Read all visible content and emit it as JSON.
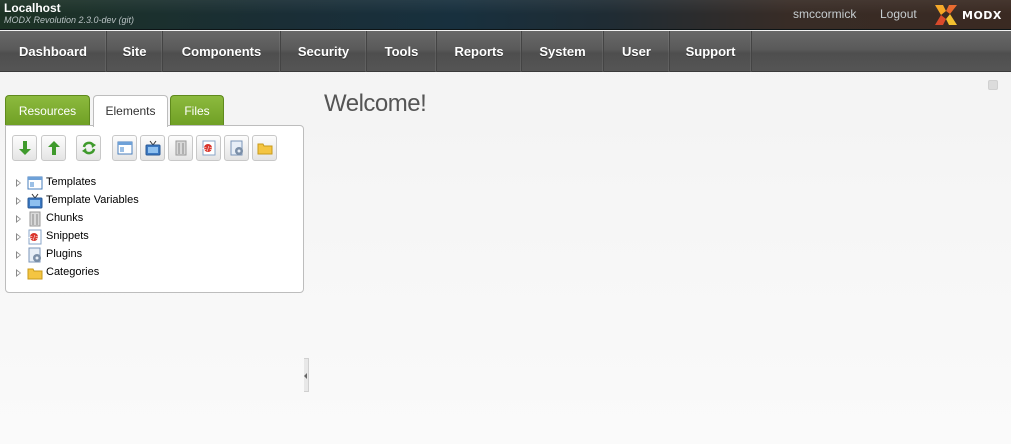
{
  "header": {
    "site_name": "Localhost",
    "version": "MODX Revolution 2.3.0-dev (git)",
    "username": "smccormick",
    "logout": "Logout",
    "logo_text": "MODX"
  },
  "nav": {
    "items": [
      "Dashboard",
      "Site",
      "Components",
      "Security",
      "Tools",
      "Reports",
      "System",
      "User",
      "Support"
    ]
  },
  "left_panel": {
    "tabs": [
      {
        "label": "Resources",
        "state": "inactive"
      },
      {
        "label": "Elements",
        "state": "active"
      },
      {
        "label": "Files",
        "state": "inactive"
      }
    ],
    "toolbar": [
      {
        "icon": "arrow-down-icon",
        "action": "expand"
      },
      {
        "icon": "arrow-up-icon",
        "action": "collapse"
      },
      {
        "icon": "refresh-icon",
        "action": "refresh"
      },
      {
        "icon": "template-icon",
        "action": "new template"
      },
      {
        "icon": "tv-icon",
        "action": "new tv"
      },
      {
        "icon": "chunk-icon",
        "action": "new chunk"
      },
      {
        "icon": "snippet-icon",
        "action": "new snippet"
      },
      {
        "icon": "plugin-icon",
        "action": "new plugin"
      },
      {
        "icon": "folder-icon",
        "action": "new category"
      }
    ],
    "tree": [
      {
        "label": "Templates",
        "icon": "template-icon"
      },
      {
        "label": "Template Variables",
        "icon": "tv-icon"
      },
      {
        "label": "Chunks",
        "icon": "chunk-icon"
      },
      {
        "label": "Snippets",
        "icon": "snippet-icon"
      },
      {
        "label": "Plugins",
        "icon": "plugin-icon"
      },
      {
        "label": "Categories",
        "icon": "folder-icon"
      }
    ]
  },
  "main": {
    "title": "Welcome!"
  },
  "colors": {
    "tab_green": "#7aab2f",
    "nav_gray": "#5a5a5a",
    "header_dark": "#1a2e36"
  }
}
